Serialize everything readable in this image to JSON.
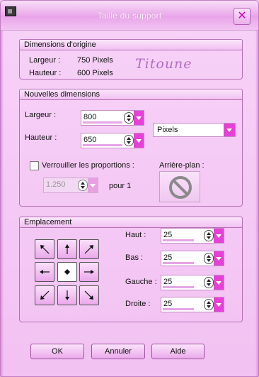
{
  "window": {
    "title": "Taille du support",
    "close_label": "✕"
  },
  "original": {
    "legend": "Dimensions d'origine",
    "width_label": "Largeur :",
    "width_value": "750 Pixels",
    "height_label": "Hauteur :",
    "height_value": "600 Pixels",
    "signature": "Titoune"
  },
  "new_dims": {
    "legend": "Nouvelles dimensions",
    "width_label": "Largeur :",
    "width_value": "800",
    "height_label": "Hauteur :",
    "height_value": "650",
    "unit_value": "Pixels",
    "lock_label": "Verrouiller les proportions :",
    "ratio_value": "1.250",
    "ratio_suffix": "pour 1",
    "background_label": "Arrière-plan :"
  },
  "placement": {
    "legend": "Emplacement",
    "top_label": "Haut :",
    "top_value": "25",
    "bottom_label": "Bas :",
    "bottom_value": "25",
    "left_label": "Gauche :",
    "left_value": "25",
    "right_label": "Droite :",
    "right_value": "25",
    "anchors": [
      "top-left-arrow-icon",
      "up-arrow-icon",
      "top-right-arrow-icon",
      "left-arrow-icon",
      "center-dot-icon",
      "right-arrow-icon",
      "bottom-left-arrow-icon",
      "down-arrow-icon",
      "bottom-right-arrow-icon"
    ]
  },
  "buttons": {
    "ok": "OK",
    "cancel": "Annuler",
    "help": "Aide"
  },
  "colors": {
    "accent": "#e640d8",
    "window_bg": "#f4c6f4",
    "signature": "#b06fc2"
  }
}
